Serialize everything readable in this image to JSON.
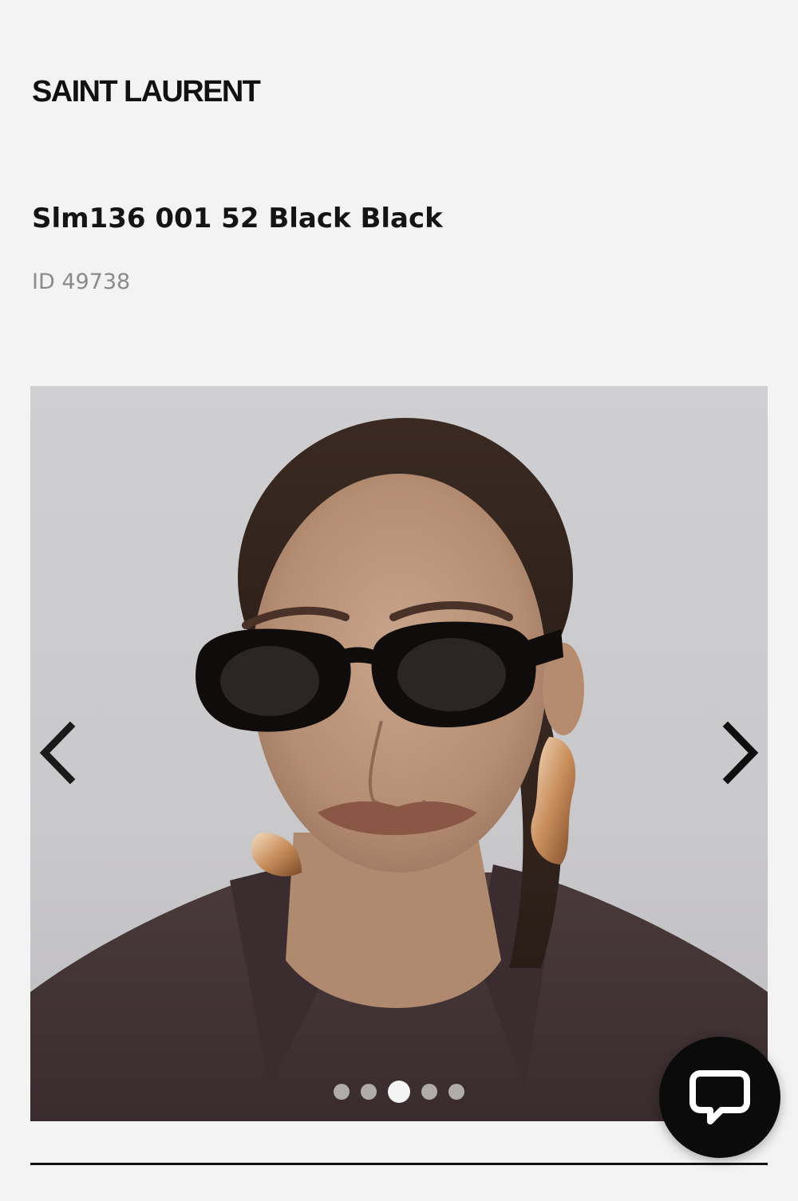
{
  "brand": {
    "name": "SAINT LAURENT"
  },
  "product": {
    "title": "Slm136 001 52 Black Black",
    "id_text": "ID 49738"
  },
  "gallery": {
    "image_count": 5,
    "active_index": 2,
    "prev_icon": "chevron-left-icon",
    "next_icon": "chevron-right-icon"
  },
  "chat": {
    "icon": "chat-bubble-icon"
  },
  "colors": {
    "background": "#f3f3f3",
    "text": "#111111",
    "muted": "#8a8a8a",
    "chat_button": "#0b0b0b"
  }
}
